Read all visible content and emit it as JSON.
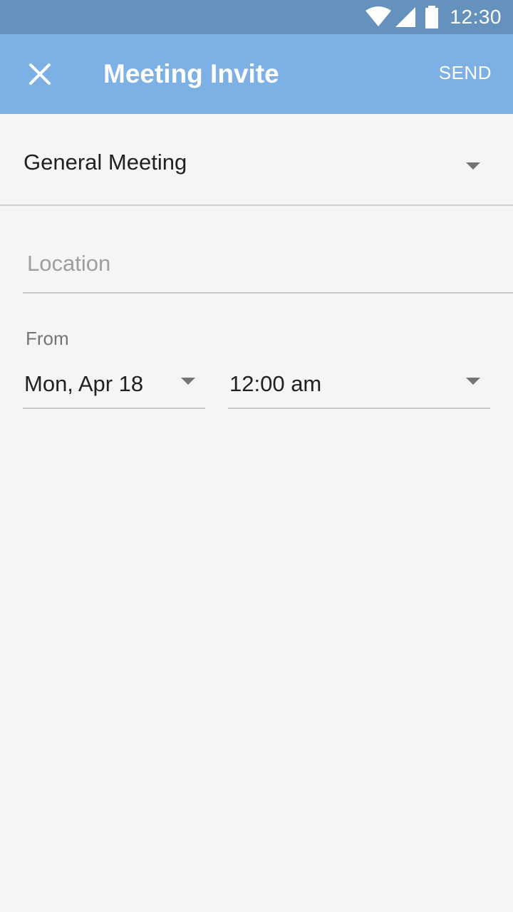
{
  "status_bar": {
    "time": "12:30",
    "icons": [
      "wifi-icon",
      "cell-signal-icon",
      "battery-icon"
    ]
  },
  "app_bar": {
    "close_icon": "close-icon",
    "title": "Meeting Invite",
    "send_label": "SEND"
  },
  "form": {
    "meeting_type": "General Meeting",
    "location_placeholder": "Location",
    "location_value": "",
    "from_label": "From",
    "from_date": "Mon, Apr 18",
    "from_time": "12:00 am"
  },
  "colors": {
    "status_bar": "#6592bd",
    "app_bar": "#7db1e5",
    "background": "#f5f5f5"
  }
}
